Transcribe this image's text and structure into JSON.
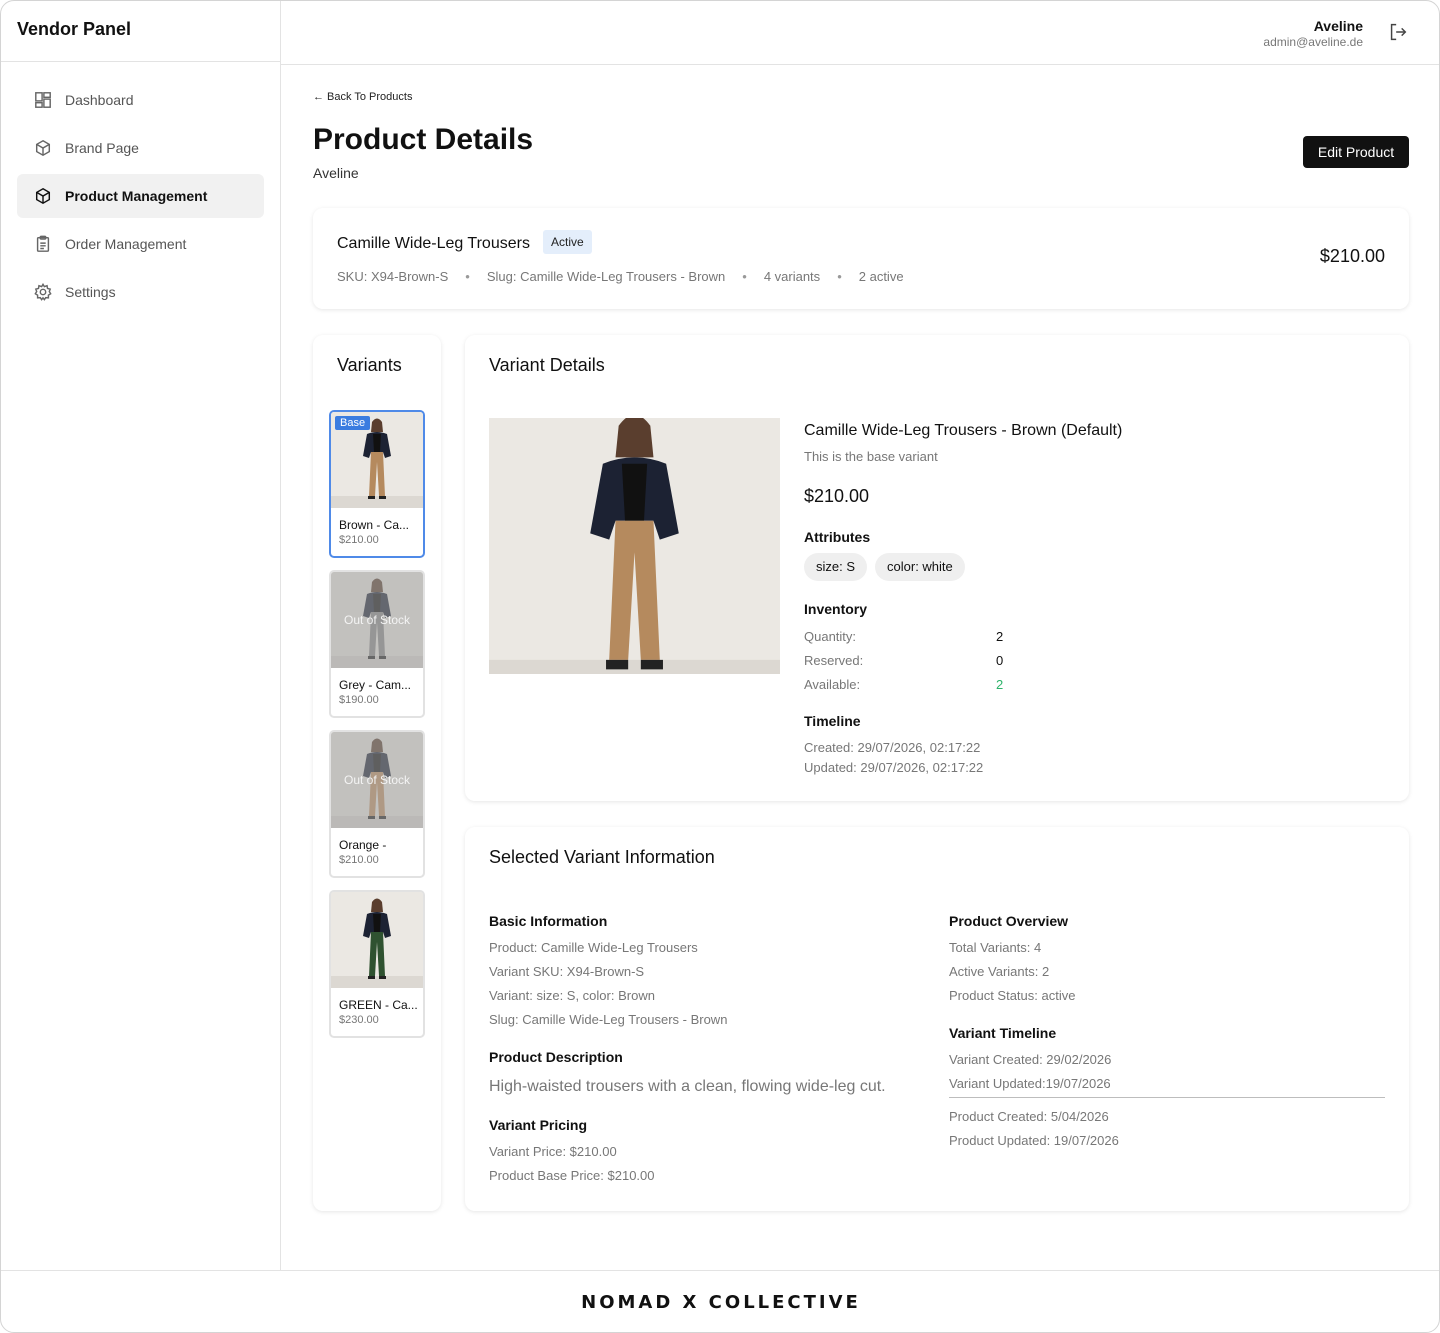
{
  "sidebar": {
    "title": "Vendor Panel",
    "items": [
      {
        "label": "Dashboard",
        "icon": "dashboard-icon",
        "active": false
      },
      {
        "label": "Brand Page",
        "icon": "box-icon",
        "active": false
      },
      {
        "label": "Product Management",
        "icon": "box-icon",
        "active": true
      },
      {
        "label": "Order Management",
        "icon": "clipboard-icon",
        "active": false
      },
      {
        "label": "Settings",
        "icon": "gear-icon",
        "active": false
      }
    ]
  },
  "header": {
    "user_name": "Aveline",
    "user_email": "admin@aveline.de",
    "logout_icon": "logout-icon"
  },
  "page": {
    "back_label": "← Back To Products",
    "title": "Product Details",
    "subtitle": "Aveline",
    "edit_label": "Edit Product"
  },
  "summary": {
    "name": "Camille Wide-Leg Trousers",
    "status": "Active",
    "sku": "SKU: X94-Brown-S",
    "slug": "Slug: Camille Wide-Leg Trousers - Brown",
    "variants": "4 variants",
    "active": "2 active",
    "price": "$210.00"
  },
  "variants": {
    "title": "Variants",
    "items": [
      {
        "name": "Brown - Ca...",
        "price": "$210.00",
        "badge": "Base",
        "out_of_stock": "",
        "pants_color": "#b58a5e"
      },
      {
        "name": "Grey - Cam...",
        "price": "$190.00",
        "badge": "",
        "out_of_stock": "Out of Stock",
        "pants_color": "#8a8a8a"
      },
      {
        "name": "Orange -",
        "price": "$210.00",
        "badge": "",
        "out_of_stock": "Out of Stock",
        "pants_color": "#c29063"
      },
      {
        "name": "GREEN - Ca...",
        "price": "$230.00",
        "badge": "",
        "out_of_stock": "",
        "pants_color": "#2f5230"
      }
    ]
  },
  "details": {
    "title": "Variant Details",
    "name": "Camille Wide-Leg Trousers - Brown (Default)",
    "note": "This is the base variant",
    "price": "$210.00",
    "attributes_label": "Attributes",
    "attributes": [
      "size: S",
      "color: white"
    ],
    "inventory_label": "Inventory",
    "inventory": [
      {
        "label": "Quantity:",
        "value": "2"
      },
      {
        "label": "Reserved:",
        "value": "0"
      },
      {
        "label": "Available:",
        "value": "2"
      }
    ],
    "available_color": "#2db36a",
    "timeline_label": "Timeline",
    "created": "Created: 29/07/2026, 02:17:22",
    "updated": "Updated: 29/07/2026, 02:17:22"
  },
  "info": {
    "title": "Selected Variant Information",
    "basic_label": "Basic Information",
    "basic": [
      "Product: Camille Wide-Leg Trousers",
      "Variant SKU:  X94-Brown-S",
      "Variant: size: S, color: Brown",
      "Slug: Camille Wide-Leg Trousers - Brown"
    ],
    "description_label": "Product Description",
    "description": "High-waisted trousers with a clean, flowing wide-leg cut.",
    "pricing_label": "Variant Pricing",
    "pricing": [
      "Variant Price: $210.00",
      "Product Base Price: $210.00"
    ],
    "overview_label": "Product Overview",
    "overview": [
      "Total Variants: 4",
      "Active Variants: 2",
      "Product Status: active"
    ],
    "vtimeline_label": "Variant Timeline",
    "vtimeline": [
      "Variant Created: 29/02/2026",
      "Variant Updated:19/07/2026"
    ],
    "ptimeline": [
      "Product Created: 5/04/2026",
      "Product Updated: 19/07/2026"
    ]
  },
  "footer": {
    "brand": "NOMAD X COLLECTIVE"
  }
}
